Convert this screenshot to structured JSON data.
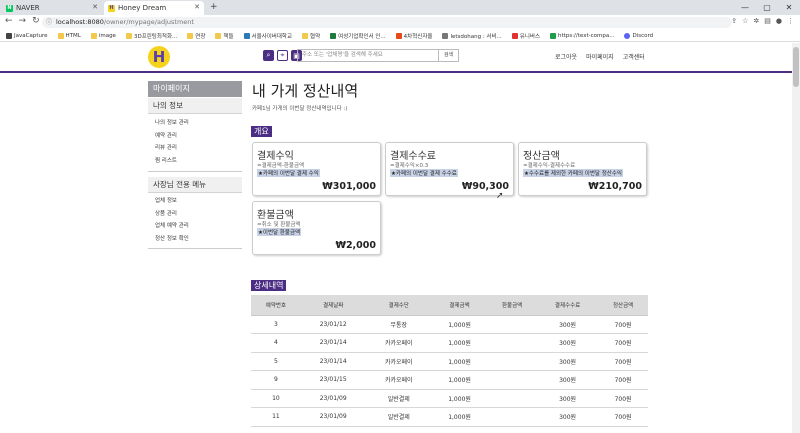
{
  "browser": {
    "tabs": [
      {
        "title": "NAVER",
        "icon_color": "#03c75a",
        "icon_letter": "N"
      },
      {
        "title": "Honey Dream",
        "icon_color": "#f5d21c",
        "icon_letter": "H"
      }
    ],
    "url_host": "localhost:8080",
    "url_path": "/owner/mypage/adjustment",
    "bookmarks": [
      "JavaCapture",
      "HTML",
      "image",
      "3D프린팅최적화...",
      "연장",
      "책들",
      "서울사이버대학교",
      "협약",
      "여성기업확인서 인...",
      "4차혁신자율",
      "letsdohang : 서비...",
      "유니버스",
      "https://text-compa...",
      "Discord"
    ]
  },
  "header": {
    "logo_letter": "H",
    "search_placeholder": "주소 또는 '업체명'을 검색해 주세요",
    "search_button": "검색",
    "nav": [
      "로그아웃",
      "마이페이지",
      "고객센터"
    ]
  },
  "sidebar": {
    "title": "마이페이지",
    "section1": "나의 정보",
    "links1": [
      "나의 정보 관리",
      "예약 관리",
      "리뷰 관리",
      "찜 리스트"
    ],
    "section2": "사장님 전용 메뉴",
    "links2": [
      "업체 정보",
      "상품 관리",
      "업체 예약 관리",
      "정산 정보 확인"
    ]
  },
  "main": {
    "title": "내 가게 정산내역",
    "subtitle": "카페1님 가게의 이번달 정산내역입니다 :)",
    "overview_label": "개요",
    "cards": [
      {
        "title": "결제수익",
        "formula": "=결제금액-환불금액",
        "note": "★카페의 이번달 결제 수익",
        "value": "₩301,000"
      },
      {
        "title": "결제수수료",
        "formula": "=결제수익×0.3",
        "note": "★카페의 이번달 결제 수수료",
        "value": "₩90,300"
      },
      {
        "title": "정산금액",
        "formula": "=결제수익-결제수수료",
        "note": "★수수료를 제외한 카페의 이번달 정산수익",
        "value": "₩210,700"
      },
      {
        "title": "환불금액",
        "formula": "=취소 및 환불금액",
        "note": "★이번달 환불금액",
        "value": "₩2,000"
      }
    ],
    "detail_label": "상세내역",
    "table": {
      "headers": [
        "예약번호",
        "결제날짜",
        "결제수단",
        "결제금액",
        "환불금액",
        "결제수수료",
        "정산금액"
      ],
      "rows": [
        [
          "3",
          "23/01/12",
          "무통장",
          "1,000원",
          "",
          "300원",
          "700원"
        ],
        [
          "4",
          "23/01/14",
          "카카오페이",
          "1,000원",
          "",
          "300원",
          "700원"
        ],
        [
          "5",
          "23/01/14",
          "카카오페이",
          "1,000원",
          "",
          "300원",
          "700원"
        ],
        [
          "9",
          "23/01/15",
          "카카오페이",
          "1,000원",
          "",
          "300원",
          "700원"
        ],
        [
          "10",
          "23/01/09",
          "일반결제",
          "1,000원",
          "",
          "300원",
          "700원"
        ],
        [
          "11",
          "23/01/09",
          "일반결제",
          "1,000원",
          "",
          "300원",
          "700원"
        ]
      ]
    }
  }
}
